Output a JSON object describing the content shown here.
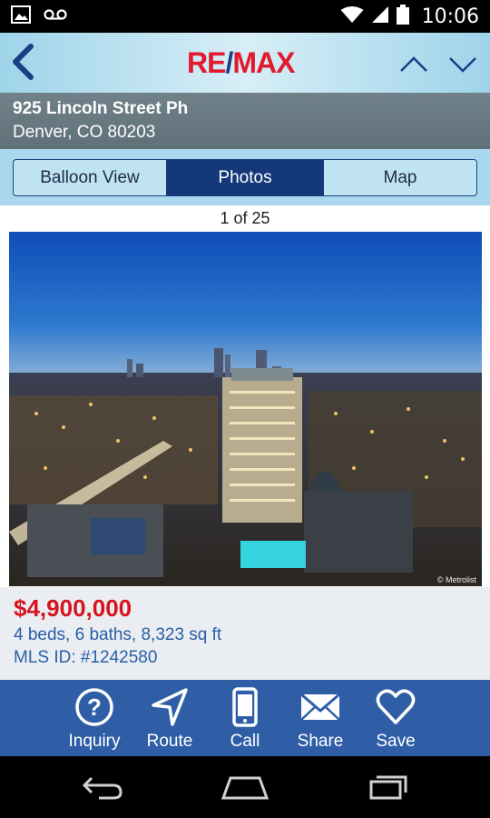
{
  "status_bar": {
    "time": "10:06",
    "icons": [
      "image-icon",
      "voicemail-icon",
      "wifi-icon",
      "signal-icon",
      "battery-icon"
    ]
  },
  "header": {
    "logo_left": "RE",
    "logo_slash": "/",
    "logo_right": "MAX",
    "icons": [
      "back-chevron-icon",
      "chevron-up-icon",
      "chevron-down-icon"
    ]
  },
  "address": {
    "street": "925  Lincoln Street Ph",
    "city": "Denver, CO 80203"
  },
  "tabs": [
    {
      "label": "Balloon View",
      "active": false
    },
    {
      "label": "Photos",
      "active": true
    },
    {
      "label": "Map",
      "active": false
    }
  ],
  "photo": {
    "counter": "1 of 25",
    "credit": "© Metrolist"
  },
  "listing": {
    "price": "$4,900,000",
    "specs": "4 beds, 6 baths, 8,323 sq ft",
    "mls": "MLS ID: #1242580"
  },
  "actions": [
    {
      "label": "Inquiry",
      "icon": "question-circle-icon"
    },
    {
      "label": "Route",
      "icon": "navigation-arrow-icon"
    },
    {
      "label": "Call",
      "icon": "phone-icon"
    },
    {
      "label": "Share",
      "icon": "envelope-icon"
    },
    {
      "label": "Save",
      "icon": "heart-icon"
    }
  ],
  "colors": {
    "price_red": "#d7131f",
    "action_bar_blue": "#2f5ea7",
    "active_tab_navy": "#14387a",
    "header_light_blue": "#a9d8ee"
  }
}
